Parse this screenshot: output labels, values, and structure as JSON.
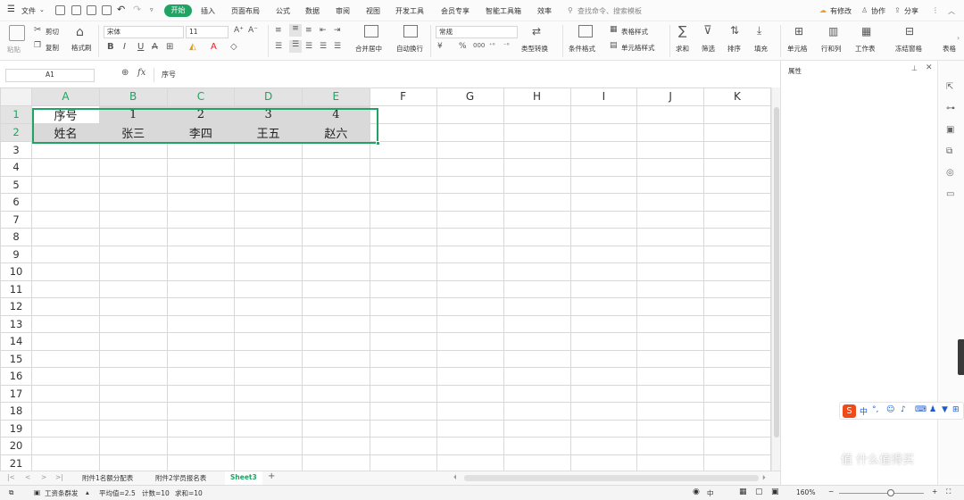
{
  "menu": {
    "file": "文件",
    "tabs": [
      "开始",
      "插入",
      "页面布局",
      "公式",
      "数据",
      "审阅",
      "视图",
      "开发工具",
      "会员专享",
      "智能工具箱",
      "效率"
    ],
    "search_placeholder": "查找命令、搜索模板",
    "right": [
      "有修改",
      "协作",
      "分享"
    ]
  },
  "toolbar": {
    "paste": "粘贴",
    "cut": "剪切",
    "copy": "复制",
    "format_painter": "格式刷",
    "font_name": "宋体",
    "font_size": "11",
    "merge": "合并居中",
    "wrap": "自动换行",
    "number_format": "常规",
    "type_convert": "类型转换",
    "cond_format": "条件格式",
    "table_style": "表格样式",
    "cell_style": "单元格样式",
    "sum": "求和",
    "filter": "筛选",
    "sort": "排序",
    "fill": "填充",
    "cells": "单元格",
    "rowcol": "行和列",
    "sheet": "工作表",
    "freeze": "冻结窗格",
    "table_tools": "表格"
  },
  "formula_bar": {
    "name_box": "A1",
    "fx": "fx",
    "content": "序号"
  },
  "grid": {
    "columns": [
      "A",
      "B",
      "C",
      "D",
      "E",
      "F",
      "G",
      "H",
      "I",
      "J",
      "K"
    ],
    "row_numbers": [
      "1",
      "2",
      "3",
      "4",
      "5",
      "6",
      "7",
      "8",
      "9",
      "10",
      "11",
      "12",
      "13",
      "14",
      "15",
      "16",
      "17",
      "18",
      "19",
      "20",
      "21"
    ],
    "rows": [
      [
        "序号",
        "1",
        "2",
        "3",
        "4"
      ],
      [
        "姓名",
        "张三",
        "李四",
        "王五",
        "赵六"
      ]
    ]
  },
  "sheet_tabs": [
    "附件1名额分配表",
    "附件2学员报名表",
    "Sheet3"
  ],
  "active_sheet": "Sheet3",
  "status": {
    "macro": "工资条群发",
    "average": "平均值=2.5",
    "count": "计数=10",
    "sum": "求和=10",
    "zoom": "160%",
    "input_lang": "中"
  },
  "panel": {
    "title": "属性"
  },
  "watermark": "值 什么值得买",
  "colors": {
    "accent": "#1fa463",
    "selection_fill": "#d9d9d9"
  }
}
